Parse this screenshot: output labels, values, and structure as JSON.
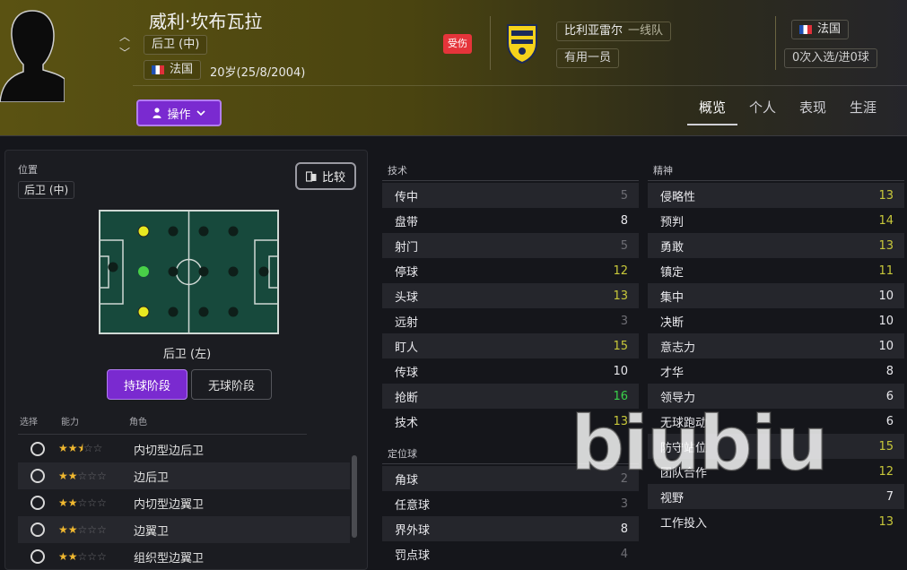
{
  "header": {
    "player_name": "威利·坎布瓦拉",
    "position": "后卫 (中)",
    "nationality": "法国",
    "age_text": "20岁(25/8/2004)",
    "status_badge": "受伤",
    "club_name": "比利亚雷尔",
    "club_team": "一线队",
    "squad_role": "有用一员",
    "national_team": "法国",
    "caps_text": "0次入选/进0球",
    "action_button": "操作",
    "tabs": [
      "概览",
      "个人",
      "表现",
      "生涯"
    ],
    "active_tab": "概览"
  },
  "position_panel": {
    "label": "位置",
    "value": "后卫 (中)",
    "compare_button": "比较",
    "selected_position": "后卫 (左)",
    "phase_tabs": [
      "持球阶段",
      "无球阶段"
    ],
    "active_phase": "持球阶段",
    "column_headers": [
      "选择",
      "能力",
      "角色"
    ],
    "roles": [
      {
        "name": "内切型边后卫",
        "stars": 2.5
      },
      {
        "name": "边后卫",
        "stars": 2
      },
      {
        "name": "内切型边翼卫",
        "stars": 2
      },
      {
        "name": "边翼卫",
        "stars": 2
      },
      {
        "name": "组织型边翼卫",
        "stars": 2
      }
    ]
  },
  "technical": {
    "title": "技术",
    "attributes": [
      {
        "name": "传中",
        "value": "5",
        "tier": "grey"
      },
      {
        "name": "盘带",
        "value": "8",
        "tier": "white"
      },
      {
        "name": "射门",
        "value": "5",
        "tier": "grey"
      },
      {
        "name": "停球",
        "value": "12",
        "tier": "yellow"
      },
      {
        "name": "头球",
        "value": "13",
        "tier": "yellow"
      },
      {
        "name": "远射",
        "value": "3",
        "tier": "grey"
      },
      {
        "name": "盯人",
        "value": "15",
        "tier": "yellow"
      },
      {
        "name": "传球",
        "value": "10",
        "tier": "white"
      },
      {
        "name": "抢断",
        "value": "16",
        "tier": "green"
      },
      {
        "name": "技术",
        "value": "13",
        "tier": "yellow"
      }
    ]
  },
  "set_pieces": {
    "title": "定位球",
    "attributes": [
      {
        "name": "角球",
        "value": "2",
        "tier": "grey"
      },
      {
        "name": "任意球",
        "value": "3",
        "tier": "grey"
      },
      {
        "name": "界外球",
        "value": "8",
        "tier": "white"
      },
      {
        "name": "罚点球",
        "value": "4",
        "tier": "grey"
      }
    ]
  },
  "mental": {
    "title": "精神",
    "attributes": [
      {
        "name": "侵略性",
        "value": "13",
        "tier": "yellow"
      },
      {
        "name": "预判",
        "value": "14",
        "tier": "yellow"
      },
      {
        "name": "勇敢",
        "value": "13",
        "tier": "yellow"
      },
      {
        "name": "镇定",
        "value": "11",
        "tier": "yellow"
      },
      {
        "name": "集中",
        "value": "10",
        "tier": "white"
      },
      {
        "name": "决断",
        "value": "10",
        "tier": "white"
      },
      {
        "name": "意志力",
        "value": "10",
        "tier": "white"
      },
      {
        "name": "才华",
        "value": "8",
        "tier": "white"
      },
      {
        "name": "领导力",
        "value": "6",
        "tier": "white"
      },
      {
        "name": "无球跑动",
        "value": "6",
        "tier": "white"
      },
      {
        "name": "防守站位",
        "value": "15",
        "tier": "yellow"
      },
      {
        "name": "团队合作",
        "value": "12",
        "tier": "yellow"
      },
      {
        "name": "视野",
        "value": "7",
        "tier": "white"
      },
      {
        "name": "工作投入",
        "value": "13",
        "tier": "yellow"
      }
    ]
  },
  "watermark": "biubiu",
  "colors": {
    "accent_purple": "#7a2ad0",
    "injured_red": "#e5343a",
    "value_yellow": "#c8c83a",
    "value_green": "#3ad04a",
    "value_grey": "#6e6e74"
  }
}
